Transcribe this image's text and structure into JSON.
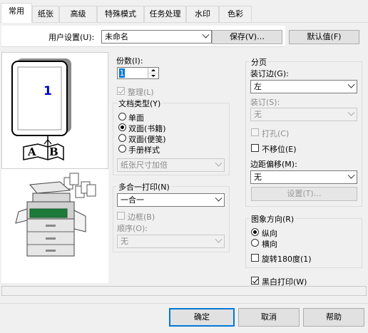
{
  "tabs": [
    "常用",
    "纸张",
    "高级",
    "特殊模式",
    "任务处理",
    "水印",
    "色彩"
  ],
  "user_settings": {
    "label": "用户设置(U):",
    "value": "未命名",
    "save_button": "保存(V)…",
    "default_button": "默认值(F)"
  },
  "preview": {
    "page_number": "1",
    "book_left": "A",
    "book_right": "B"
  },
  "copies": {
    "label": "份数(I):",
    "value": "1"
  },
  "collate": {
    "label": "整理(L)",
    "checked": true,
    "disabled": true
  },
  "document_type": {
    "label": "文档类型(Y)",
    "options": [
      "单面",
      "双面(书籍)",
      "双面(便笺)",
      "手册样式"
    ],
    "selected": "双面(书籍)",
    "paper_size_select": "纸张尺寸加倍"
  },
  "n_up": {
    "label": "多合一打印(N)",
    "value": "一合一",
    "border_label": "边框(B)",
    "order_label": "顺序(O):",
    "order_value": "无"
  },
  "pagination": {
    "group_label": "分页",
    "binding_edge_label": "装订边(G):",
    "binding_edge_value": "左",
    "staple_label": "装订(S):",
    "staple_value": "无",
    "punch_label": "打孔(C)",
    "no_offset_label": "不移位(E)",
    "margin_shift_label": "边距偏移(M):",
    "margin_shift_value": "无",
    "settings_button": "设置(T)…"
  },
  "orientation": {
    "group_label": "图象方向(R)",
    "portrait": "纵向",
    "landscape": "横向",
    "rotate_label": "旋转180度(1)",
    "selected": "纵向"
  },
  "bw_print": {
    "label": "黑白打印(W)",
    "checked": true
  },
  "footer": {
    "ok": "确定",
    "cancel": "取消",
    "help": "帮助"
  },
  "colors": {
    "accent": "#0078d7",
    "page_number": "#0000cc",
    "printer_green": "#1e7a3a"
  }
}
